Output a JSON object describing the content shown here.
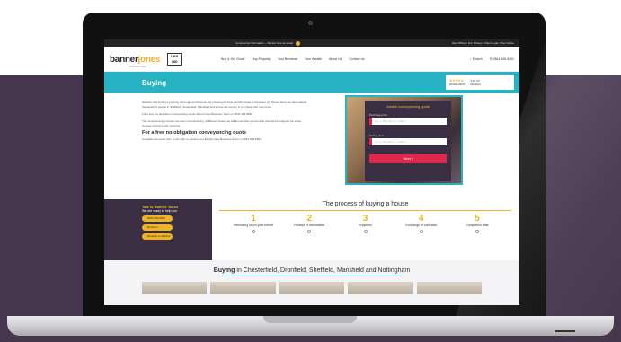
{
  "topbar": {
    "notice": "Coronavirus Information – We are here as usual",
    "links": "Hire Offices | Our Privacy | Client Login | Pay Online"
  },
  "nav": {
    "logo_main": "banner",
    "logo_accent": "jones",
    "logo_sub": "SURVEYORS",
    "seal": "UKS 360",
    "items": [
      "Buy & Sell Guide",
      "Buy Property",
      "Your Business",
      "Your Wealth",
      "About Us",
      "Contact Us"
    ],
    "search_label": "Search",
    "phone": "0844 469 8381"
  },
  "hero": {
    "title": "Buying",
    "rating_label": "EXCELLENT",
    "rating_score": "9.8 / 10",
    "rating_count": "Reviews"
  },
  "content": {
    "p1": "Whether that buying a property is a huge commitment and ensuring the best decision made is important. At Banner Jones we have helped thousands of people in Sheffield, Chesterfield, Mansfield and across the country to purchase their new home.",
    "p2": "For a free, no obligation conveyancing quote call our New Business Team on 0844 469 8381",
    "p3": "The conveyancing process can seem overwhelming. At Banner Jones, we will ensure that you are kept informed throughout the entire process of buying your property.",
    "heading": "For a free no-obligation conveyancing quote",
    "p4": "Complete the quote form to the right or speak to our friendly New Business Team on 0844 469 8381"
  },
  "quote": {
    "title": "Instant conveyancing quote",
    "purchase_label": "Purchase price",
    "purchase_placeholder": "£   e.g. 200,000 or 1 million",
    "selling_label": "Selling price",
    "selling_placeholder": "£   e.g. 200,000 or 1 million",
    "button": "Next"
  },
  "contact": {
    "title": "Talk to Banner Jones",
    "subtitle": "We are ready to help you",
    "buttons": [
      "0844 469 8381",
      "Email us",
      "Request a callback"
    ]
  },
  "process": {
    "title": "The process of buying a house",
    "steps": [
      {
        "num": "1",
        "label": "Instructing us on your behalf"
      },
      {
        "num": "2",
        "label": "Receipt of information"
      },
      {
        "num": "3",
        "label": "Enquiries"
      },
      {
        "num": "4",
        "label": "Exchange of contracts"
      },
      {
        "num": "5",
        "label": "Completion date"
      }
    ]
  },
  "bottom": {
    "bold": "Buying",
    "rest": " in Chesterfield, Dronfield, Sheffield, Mansfield and Nottingham"
  }
}
